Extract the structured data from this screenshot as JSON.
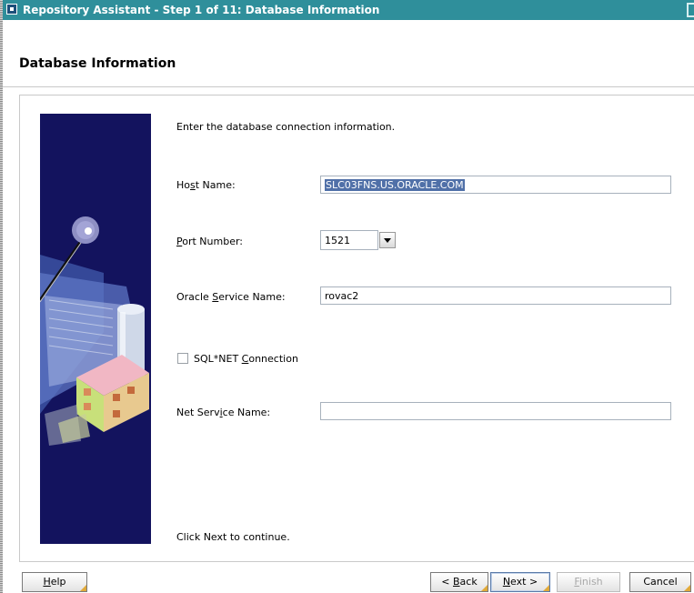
{
  "window": {
    "title": "Repository Assistant - Step 1 of 11: Database Information"
  },
  "page": {
    "title": "Database Information",
    "instruction": "Enter the database connection information.",
    "footer_hint": "Click Next to continue."
  },
  "form": {
    "host_name": {
      "label_pre": "Ho",
      "label_mnemonic": "s",
      "label_post": "t Name:",
      "value": "SLC03FNS.US.ORACLE.COM"
    },
    "port_number": {
      "label_mnemonic": "P",
      "label_post": "ort Number:",
      "value": "1521"
    },
    "service_name": {
      "label_pre": "Oracle ",
      "label_mnemonic": "S",
      "label_post": "ervice Name:",
      "value": "rovac2"
    },
    "sqlnet": {
      "label_pre": "SQL*NET ",
      "label_mnemonic": "C",
      "label_post": "onnection",
      "checked": false
    },
    "net_service_name": {
      "label_pre": "Net Serv",
      "label_mnemonic": "i",
      "label_post": "ce Name:",
      "value": ""
    }
  },
  "buttons": {
    "help": {
      "mnemonic": "H",
      "rest": "elp"
    },
    "back": {
      "pre": "< ",
      "mnemonic": "B",
      "rest": "ack"
    },
    "next": {
      "mnemonic": "N",
      "rest": "ext >"
    },
    "finish": {
      "mnemonic": "F",
      "rest": "inish"
    },
    "cancel": {
      "label": "Cancel"
    }
  },
  "colors": {
    "titlebar": "#2f8f9b",
    "side_art_background": "#13135e",
    "selection": "#5070a8"
  }
}
